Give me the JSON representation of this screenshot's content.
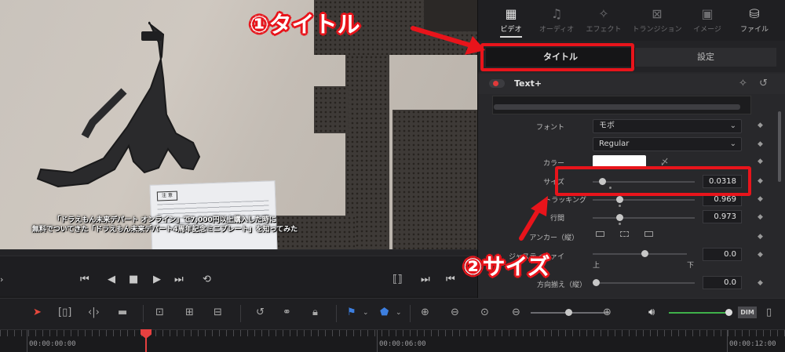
{
  "viewer": {
    "caption_line1": "「ドラえもん未来デパート オンライン」で7,000円以上購入した時に",
    "caption_line2": "無料でついてきた「ドラえもん未来デパート4周年記念ミニプレート」を知ってみた",
    "card_warning": "注 意"
  },
  "inspector": {
    "tabs": [
      {
        "label": "ビデオ",
        "icon": "film-icon",
        "active": true
      },
      {
        "label": "オーディオ",
        "icon": "music-note-icon",
        "active": false
      },
      {
        "label": "エフェクト",
        "icon": "magic-wand-icon",
        "active": false
      },
      {
        "label": "トランジション",
        "icon": "transition-icon",
        "active": false
      },
      {
        "label": "イメージ",
        "icon": "image-icon",
        "active": false
      },
      {
        "label": "ファイル",
        "icon": "file-icon",
        "active": false
      }
    ],
    "subtabs": {
      "title": "タイトル",
      "settings": "設定"
    },
    "section_title": "Text+",
    "props": {
      "font_label": "フォント",
      "font_value": "モボ",
      "style_value": "Regular",
      "color_label": "カラー",
      "color_value": "#ffffff",
      "size_label": "サイズ",
      "size_value": "0.0318",
      "tracking_label": "トラッキング",
      "tracking_value": "0.969",
      "linespacing_label": "行間",
      "linespacing_value": "0.973",
      "anchor_label": "アンカー（縦）",
      "justify_label": "ジャスティファイ",
      "justify_value": "0.0",
      "justify_top": "上",
      "justify_bottom": "下",
      "direction_label": "方向揃え（縦）",
      "direction_value": "0.0"
    }
  },
  "timeline": {
    "timecodes": [
      "00:00:00:00",
      "00:00:06:00",
      "00:00:12:00"
    ],
    "dim_label": "DIM"
  },
  "annotations": {
    "title_callout": "①タイトル",
    "size_callout": "②サイズ"
  },
  "colors": {
    "accent_red": "#e8141b",
    "playhead": "#e64040",
    "volume": "#3fb14a"
  }
}
